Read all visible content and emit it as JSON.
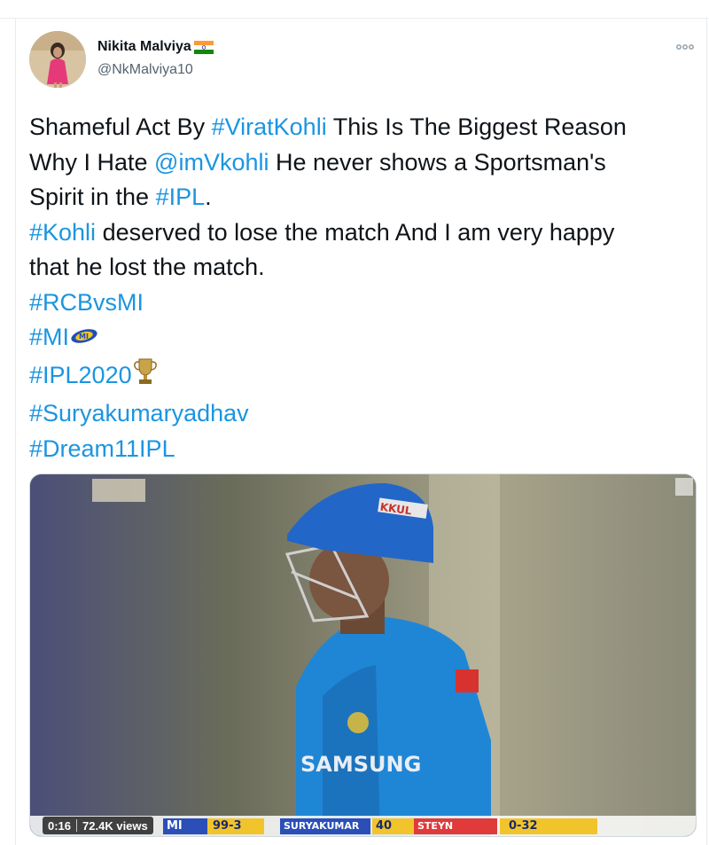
{
  "author": {
    "display_name": "Nikita Malviya",
    "handle": "@NkMalviya10",
    "flag_icon": "india-flag-icon"
  },
  "menu": {
    "icon": "more-horizontal-icon"
  },
  "tweet": {
    "line1_a": "Shameful Act By ",
    "line1_tag": "#ViratKohli",
    "line1_b": " This Is The Biggest Reason",
    "line2_a": "Why I Hate ",
    "line2_mention": "@imVkohli",
    "line2_b": " He never shows a Sportsman's",
    "line3_a": "Spirit in the ",
    "line3_tag": "#IPL",
    "line3_b": ".",
    "line4_tag": "#Kohli",
    "line4_b": " deserved to lose the match And I am very happy",
    "line5": "that he lost the match.",
    "tags": [
      "#RCBvsMI",
      "#MI",
      "#IPL2020",
      "#Suryakumaryadhav",
      "#Dream11IPL"
    ],
    "tag_color": "#1b95e0"
  },
  "video": {
    "duration": "0:16",
    "views": "72.4K views",
    "scorebar": {
      "team": "MI",
      "score": "99-3",
      "batsman": "SURYAKUMAR",
      "batsman_runs": "40",
      "bowler": "STEYN",
      "bowler_figures": "0-32"
    },
    "jersey_text": "SAMSUNG",
    "helmet_text": "KKUL"
  }
}
